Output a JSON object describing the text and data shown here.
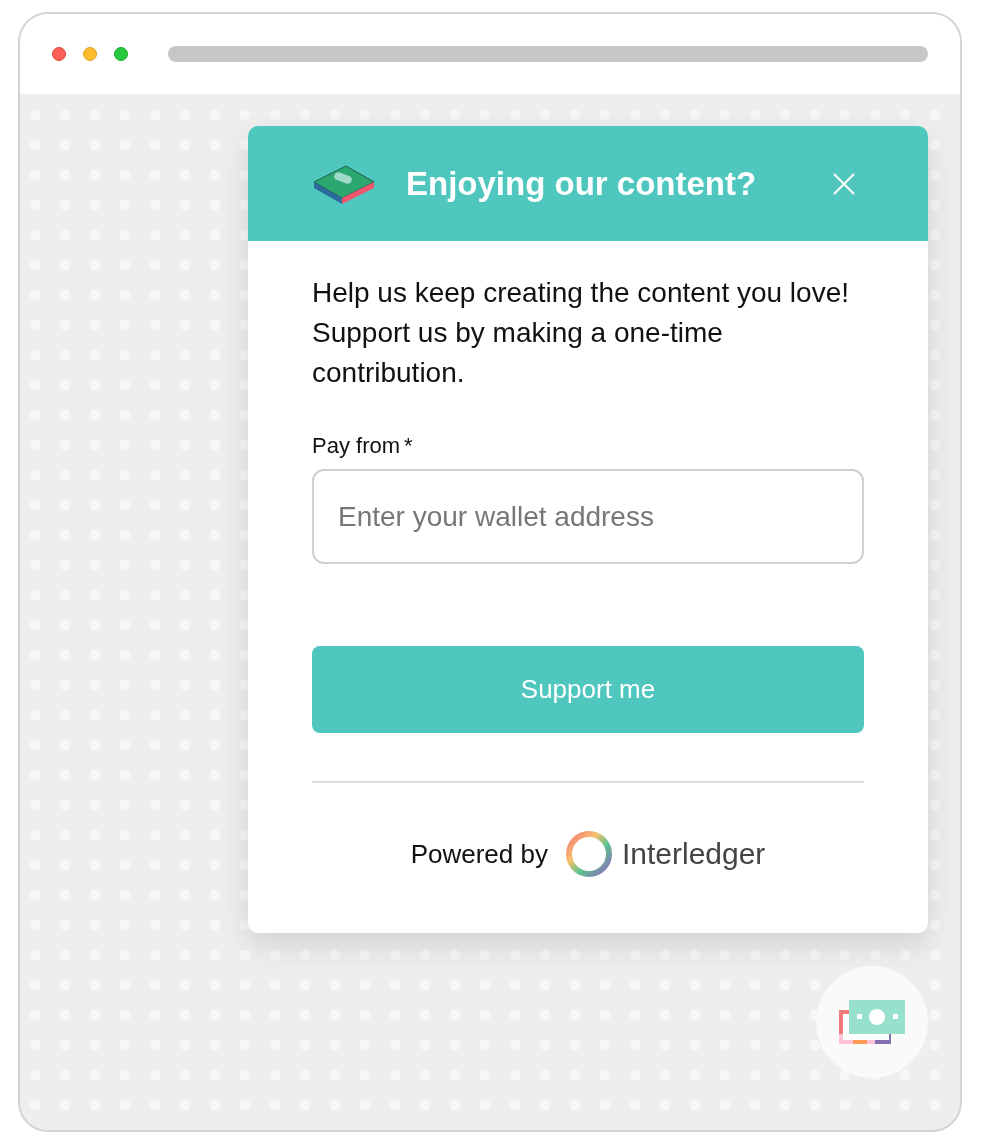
{
  "popup": {
    "title": "Enjoying our content?",
    "message": "Help us keep creating the content you love! Support us by making a one-time contribution.",
    "field": {
      "label": "Pay from",
      "required_mark": "*",
      "placeholder": "Enter your wallet address"
    },
    "button": "Support me",
    "footer": {
      "prefix": "Powered by",
      "brand": "Interledger"
    }
  }
}
